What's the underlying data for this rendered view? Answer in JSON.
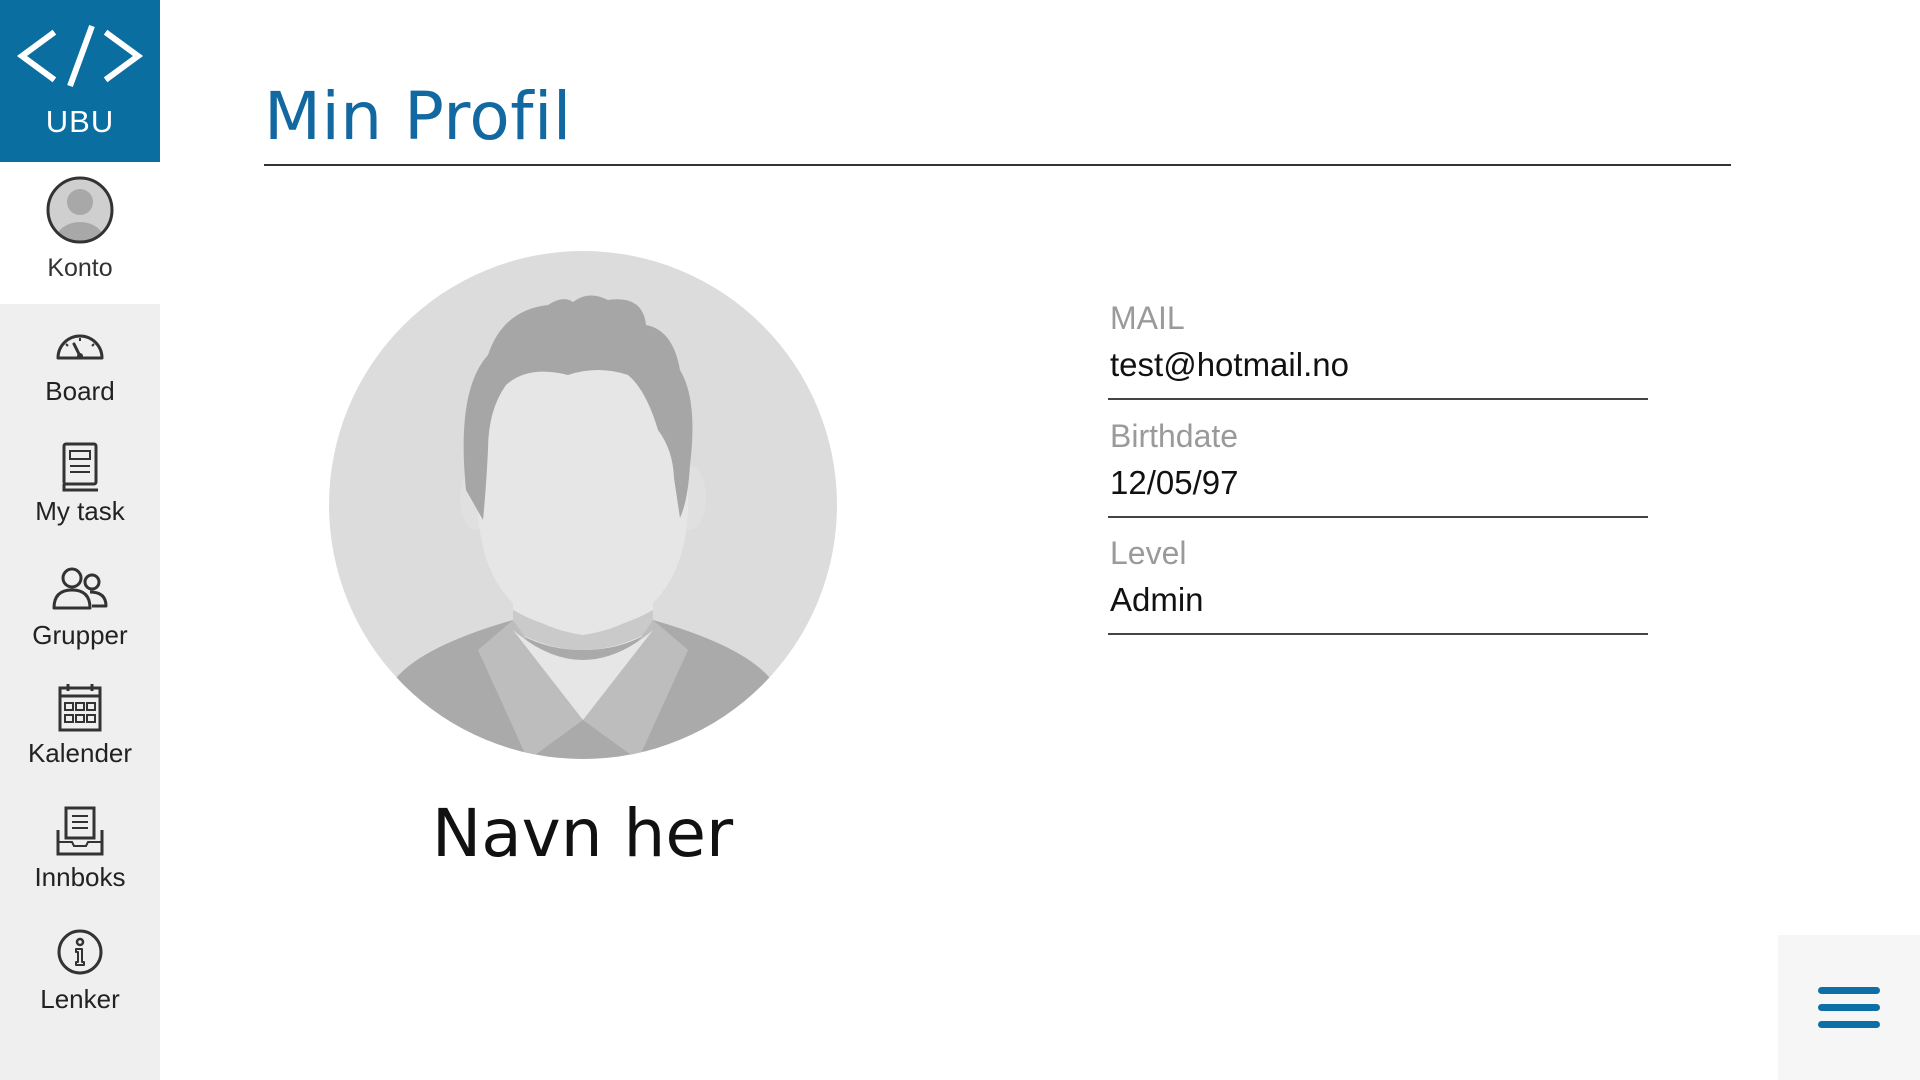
{
  "logo": {
    "text": "UBU",
    "icon": "code-brackets-icon"
  },
  "account": {
    "label": "Konto",
    "icon": "user-avatar-icon"
  },
  "sidebar": {
    "items": [
      {
        "label": "Board",
        "icon": "gauge-icon"
      },
      {
        "label": "My task",
        "icon": "book-icon"
      },
      {
        "label": "Grupper",
        "icon": "users-icon"
      },
      {
        "label": "Kalender",
        "icon": "calendar-icon"
      },
      {
        "label": "Innboks",
        "icon": "inbox-icon"
      },
      {
        "label": "Lenker",
        "icon": "info-icon"
      }
    ]
  },
  "main": {
    "title": "Min Profil",
    "profile": {
      "name": "Navn her"
    },
    "fields": [
      {
        "label": "MAIL",
        "value": "test@hotmail.no"
      },
      {
        "label": "Birthdate",
        "value": "12/05/97"
      },
      {
        "label": "Level",
        "value": "Admin"
      }
    ]
  },
  "colors": {
    "accent": "#0b6ea0",
    "title": "#1268a0",
    "sidebar_bg": "#efefef",
    "menu_icon": "#0e6ea6"
  },
  "menu": {
    "icon": "hamburger-menu-icon"
  }
}
